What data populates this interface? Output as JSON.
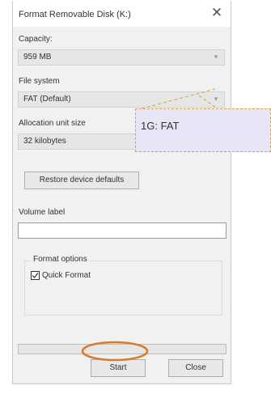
{
  "window": {
    "title": "Format Removable Disk (K:)",
    "close_glyph": "✕"
  },
  "capacity": {
    "label": "Capacity:",
    "value": "959 MB"
  },
  "file_system": {
    "label": "File system",
    "value": "FAT (Default)"
  },
  "allocation": {
    "label": "Allocation unit size",
    "value": "32 kilobytes"
  },
  "buttons": {
    "restore": "Restore device defaults",
    "start": "Start",
    "close": "Close"
  },
  "volume": {
    "label": "Volume label",
    "value": ""
  },
  "format_options": {
    "title": "Format options",
    "quick_format_label": "Quick Format",
    "quick_format_checked": true
  },
  "progress": {
    "fraction": 0
  },
  "annotation": {
    "text": "1G: FAT",
    "border_color": "#d4a24c",
    "fill_color": "#e7e5f6"
  },
  "highlight": {
    "color": "#d87a2c"
  },
  "icons": {
    "dropdown": "chevron-down-icon",
    "close": "close-icon",
    "check": "checkmark-icon"
  }
}
